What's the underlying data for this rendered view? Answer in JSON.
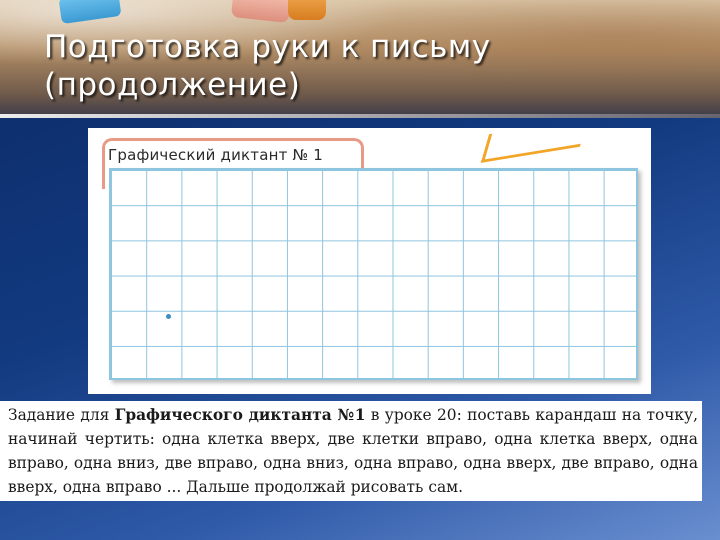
{
  "slide": {
    "title_line1": "Подготовка руки к письму",
    "title_line2": "(продолжение)"
  },
  "worksheet": {
    "label": "Графический диктант № 1",
    "grid_columns": 15,
    "grid_rows": 6,
    "grid_color": "#8ec5df",
    "frame_color": "#e79a86",
    "dot_color": "#3a8fc0"
  },
  "task": {
    "intro": "Задание для ",
    "bold1": "Графического диктанта №1",
    "mid": " в уроке 20: поставь карандаш на точку, начинай чертить: одна клетка вверх, две клетки вправо, одна клетка вверх, одна вправо, одна вниз, две вправо, одна вниз, одна вправо, одна вверх, две вправо, одна вверх, одна вправо ... Дальше продолжай рисовать сам."
  },
  "colors": {
    "background": "#123a80",
    "title_text": "#ffffff"
  }
}
